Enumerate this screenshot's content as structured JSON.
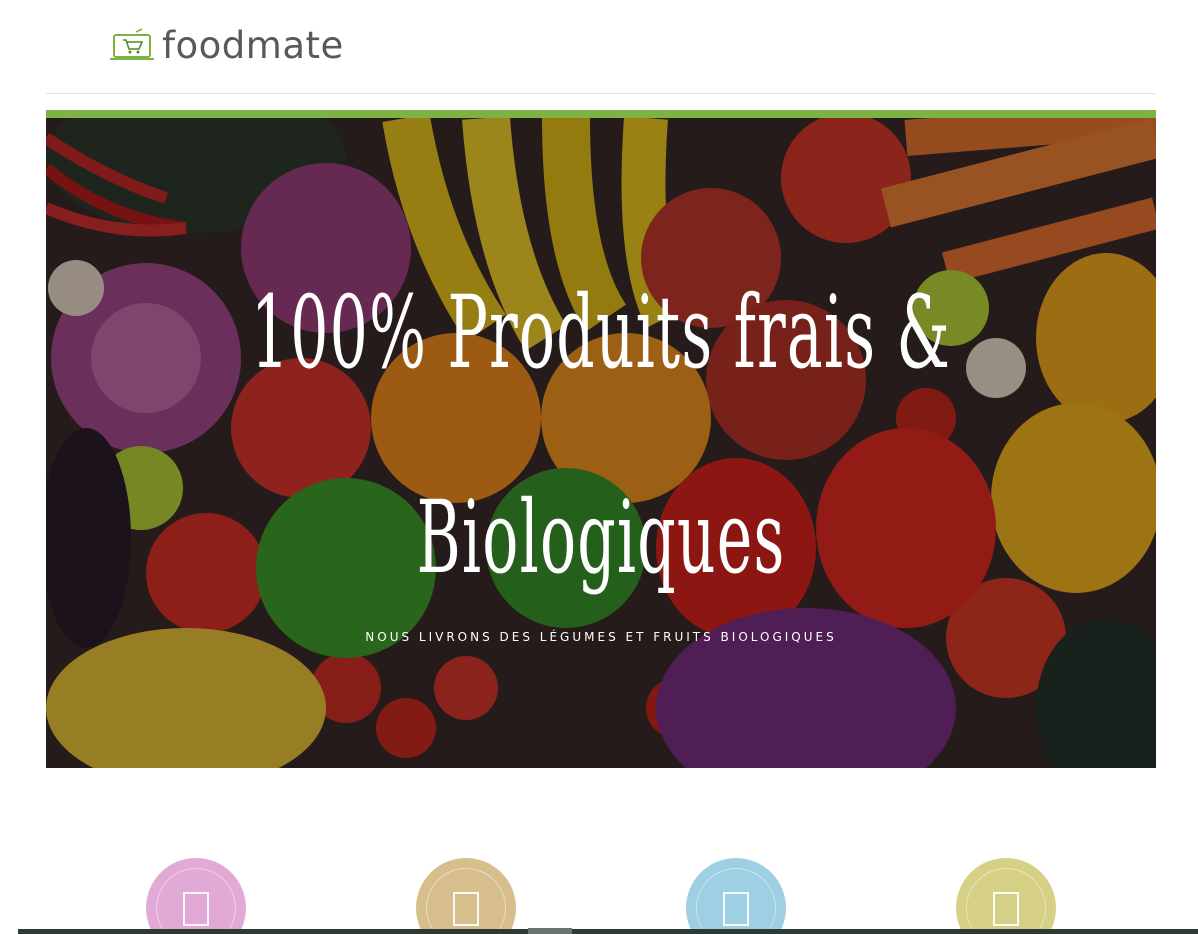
{
  "brand": {
    "name": "foodmate",
    "accent": "#7cb342",
    "text_color": "#555a5f"
  },
  "hero": {
    "title": "100% Produits frais & Biologiques",
    "subtitle": "NOUS LIVRONS DES LÉGUMES ET FRUITS BIOLOGIQUES",
    "overlay_color": "rgba(0,0,0,0.35)"
  },
  "features": [
    {
      "icon": "placeholder-glyph-icon",
      "color": "#e1a9d6"
    },
    {
      "icon": "placeholder-glyph-icon",
      "color": "#d6bf8c"
    },
    {
      "icon": "placeholder-glyph-icon",
      "color": "#9fcfe3"
    },
    {
      "icon": "placeholder-glyph-icon",
      "color": "#d6cf86"
    }
  ]
}
